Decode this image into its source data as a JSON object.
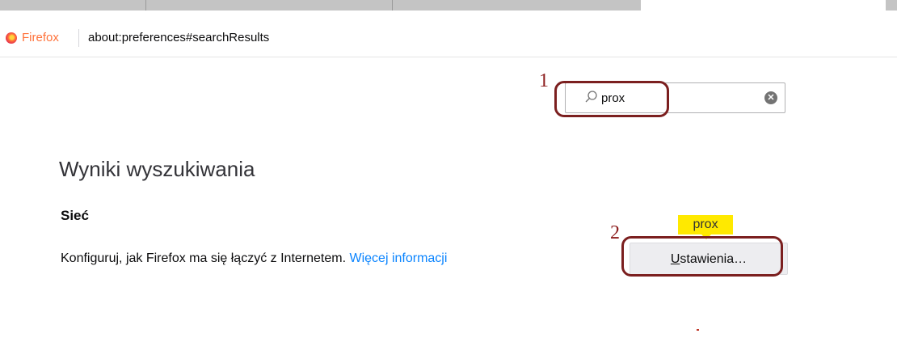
{
  "browser": {
    "identity_label": "Firefox",
    "url": "about:preferences#searchResults"
  },
  "search": {
    "value": "prox",
    "placeholder": ""
  },
  "results": {
    "title": "Wyniki wyszukiwania",
    "section": {
      "title": "Sieć",
      "description": "Konfiguruj, jak Firefox ma się łączyć z Internetem.",
      "link": "Więcej informacji",
      "tooltip": "prox",
      "button_label": "Ustawienia…"
    }
  },
  "annotations": {
    "step1": "1",
    "step2": "2"
  },
  "colors": {
    "annotation": "#7b1f1f",
    "link": "#0a84ff",
    "tooltip": "#ffe900",
    "firefox_brand": "#ff7139"
  }
}
